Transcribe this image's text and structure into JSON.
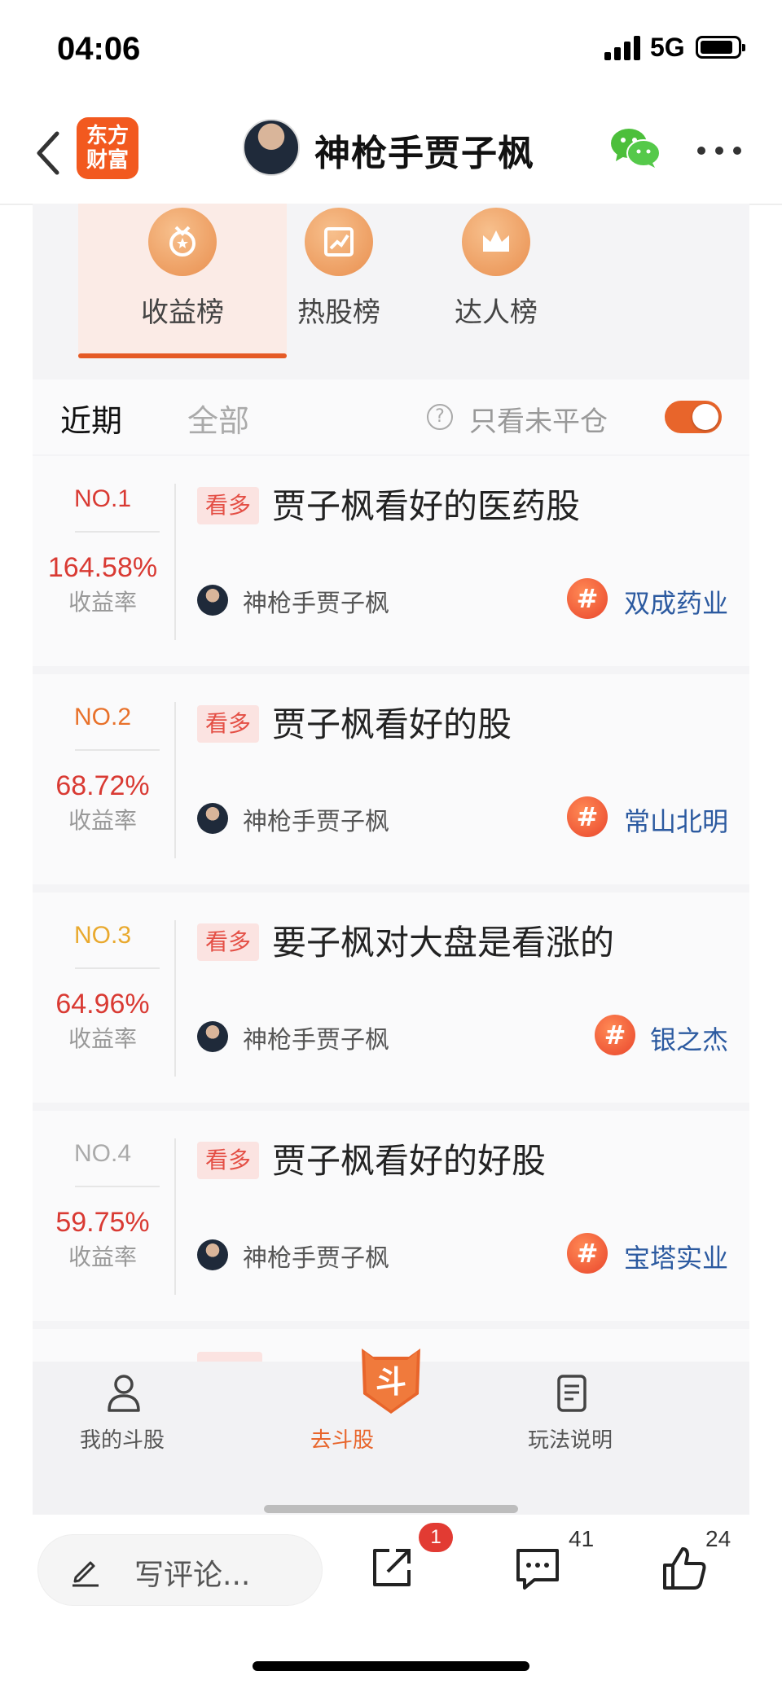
{
  "status": {
    "time": "04:06",
    "network": "5G"
  },
  "nav": {
    "logo_line1": "东方",
    "logo_line2": "财富",
    "title": "神枪手贾子枫"
  },
  "tabs": [
    {
      "label": "收益榜",
      "icon": "medal-icon",
      "active": true
    },
    {
      "label": "热股榜",
      "icon": "trend-chart-icon",
      "active": false
    },
    {
      "label": "达人榜",
      "icon": "crown-icon",
      "active": false
    }
  ],
  "filter": {
    "recent": "近期",
    "all": "全部",
    "only_open": "只看未平仓",
    "help": "?"
  },
  "cards": [
    {
      "rank": "NO.1",
      "rank_color": "#d93a33",
      "rate": "164.58%",
      "rate_label": "收益率",
      "tag": "看多",
      "title": "贾子枫看好的医药股",
      "user": "神枪手贾子枫",
      "stock": "双成药业"
    },
    {
      "rank": "NO.2",
      "rank_color": "#e8712a",
      "rate": "68.72%",
      "rate_label": "收益率",
      "tag": "看多",
      "title": "贾子枫看好的股",
      "user": "神枪手贾子枫",
      "stock": "常山北明"
    },
    {
      "rank": "NO.3",
      "rank_color": "#e9a92e",
      "rate": "64.96%",
      "rate_label": "收益率",
      "tag": "看多",
      "title": "要子枫对大盘是看涨的",
      "user": "神枪手贾子枫",
      "stock": "银之杰"
    },
    {
      "rank": "NO.4",
      "rank_color": "#aaaaaa",
      "rate": "59.75%",
      "rate_label": "收益率",
      "tag": "看多",
      "title": "贾子枫看好的好股",
      "user": "神枪手贾子枫",
      "stock": "宝塔实业"
    }
  ],
  "bottom_nav": {
    "my": "我的斗股",
    "go": "去斗股",
    "go_glyph": "斗",
    "rules": "玩法说明"
  },
  "footer": {
    "placeholder": "写评论...",
    "share_badge": "1",
    "comment_count": "41",
    "like_count": "24"
  }
}
